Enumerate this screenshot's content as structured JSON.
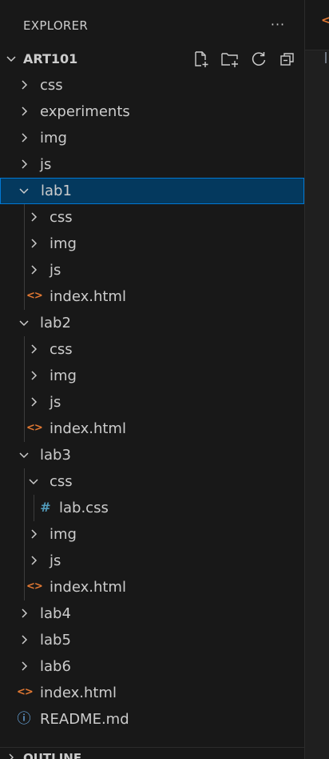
{
  "explorer": {
    "title": "EXPLORER",
    "more_actions_label": "···"
  },
  "workspace": {
    "name": "ART101",
    "actions": [
      "new-file",
      "new-folder",
      "refresh",
      "collapse-all"
    ]
  },
  "tree": [
    {
      "label": "css",
      "type": "folder",
      "expanded": false,
      "depth": 0
    },
    {
      "label": "experiments",
      "type": "folder",
      "expanded": false,
      "depth": 0
    },
    {
      "label": "img",
      "type": "folder",
      "expanded": false,
      "depth": 0
    },
    {
      "label": "js",
      "type": "folder",
      "expanded": false,
      "depth": 0
    },
    {
      "label": "lab1",
      "type": "folder",
      "expanded": true,
      "depth": 0,
      "selected": true
    },
    {
      "label": "css",
      "type": "folder",
      "expanded": false,
      "depth": 1
    },
    {
      "label": "img",
      "type": "folder",
      "expanded": false,
      "depth": 1
    },
    {
      "label": "js",
      "type": "folder",
      "expanded": false,
      "depth": 1
    },
    {
      "label": "index.html",
      "type": "html",
      "depth": 1
    },
    {
      "label": "lab2",
      "type": "folder",
      "expanded": true,
      "depth": 0
    },
    {
      "label": "css",
      "type": "folder",
      "expanded": false,
      "depth": 1
    },
    {
      "label": "img",
      "type": "folder",
      "expanded": false,
      "depth": 1
    },
    {
      "label": "js",
      "type": "folder",
      "expanded": false,
      "depth": 1
    },
    {
      "label": "index.html",
      "type": "html",
      "depth": 1
    },
    {
      "label": "lab3",
      "type": "folder",
      "expanded": true,
      "depth": 0
    },
    {
      "label": "css",
      "type": "folder",
      "expanded": true,
      "depth": 1
    },
    {
      "label": "lab.css",
      "type": "css",
      "depth": 2
    },
    {
      "label": "img",
      "type": "folder",
      "expanded": false,
      "depth": 1
    },
    {
      "label": "js",
      "type": "folder",
      "expanded": false,
      "depth": 1
    },
    {
      "label": "index.html",
      "type": "html",
      "depth": 1
    },
    {
      "label": "lab4",
      "type": "folder",
      "expanded": false,
      "depth": 0
    },
    {
      "label": "lab5",
      "type": "folder",
      "expanded": false,
      "depth": 0
    },
    {
      "label": "lab6",
      "type": "folder",
      "expanded": false,
      "depth": 0
    },
    {
      "label": "index.html",
      "type": "html",
      "depth": 0
    },
    {
      "label": "README.md",
      "type": "info",
      "depth": 0
    }
  ],
  "outline": {
    "title": "OUTLINE"
  },
  "colors": {
    "background": "#181818",
    "selection_bg": "#04395e",
    "selection_border": "#0078d4",
    "text": "#cccccc",
    "html_icon": "#e37933",
    "css_icon": "#519aba",
    "info_icon": "#75beff"
  }
}
